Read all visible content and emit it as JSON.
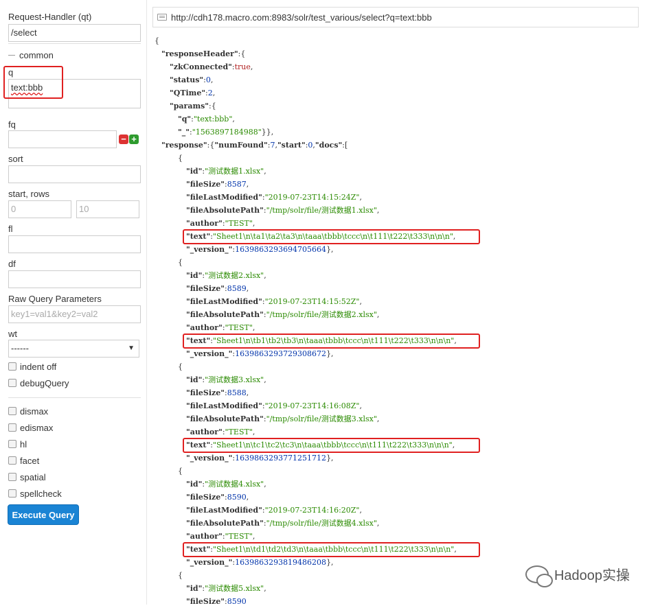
{
  "form": {
    "request_handler_label": "Request-Handler (qt)",
    "request_handler_value": "/select",
    "common_legend": "common",
    "q_label": "q",
    "q_value": "text:bbb",
    "fq_label": "fq",
    "sort_label": "sort",
    "start_rows_label": "start, rows",
    "start_placeholder": "0",
    "rows_placeholder": "10",
    "fl_label": "fl",
    "df_label": "df",
    "raw_params_label": "Raw Query Parameters",
    "raw_params_placeholder": "key1=val1&key2=val2",
    "wt_label": "wt",
    "wt_value": "------",
    "indent_off_label": "indent off",
    "debug_query_label": "debugQuery",
    "options": [
      "dismax",
      "edismax",
      "hl",
      "facet",
      "spatial",
      "spellcheck"
    ],
    "execute_label": "Execute Query"
  },
  "url": "http://cdh178.macro.com:8983/solr/test_various/select?q=text:bbb",
  "response": {
    "zkConnected": "true",
    "status": "0",
    "QTime": "2",
    "q": "\"text:bbb\"",
    "_": "\"1563897184988\"",
    "numFound": "7",
    "start": "0",
    "docs": [
      {
        "id": "\"测试数据1.xlsx\"",
        "fileSize": "8587",
        "fileLastModified": "\"2019-07-23T14:15:24Z\"",
        "fileAbsolutePath": "\"/tmp/solr/file/测试数据1.xlsx\"",
        "author": "\"TEST\"",
        "text": "\"Sheet1\\n\\ta1\\ta2\\ta3\\n\\taaa\\tbbb\\tccc\\n\\t111\\t222\\t333\\n\\n\\n\"",
        "version": "1639863293694705664"
      },
      {
        "id": "\"测试数据2.xlsx\"",
        "fileSize": "8589",
        "fileLastModified": "\"2019-07-23T14:15:52Z\"",
        "fileAbsolutePath": "\"/tmp/solr/file/测试数据2.xlsx\"",
        "author": "\"TEST\"",
        "text": "\"Sheet1\\n\\tb1\\tb2\\tb3\\n\\taaa\\tbbb\\tccc\\n\\t111\\t222\\t333\\n\\n\\n\"",
        "version": "1639863293729308672"
      },
      {
        "id": "\"测试数据3.xlsx\"",
        "fileSize": "8588",
        "fileLastModified": "\"2019-07-23T14:16:08Z\"",
        "fileAbsolutePath": "\"/tmp/solr/file/测试数据3.xlsx\"",
        "author": "\"TEST\"",
        "text": "\"Sheet1\\n\\tc1\\tc2\\tc3\\n\\taaa\\tbbb\\tccc\\n\\t111\\t222\\t333\\n\\n\\n\"",
        "version": "1639863293771251712"
      },
      {
        "id": "\"测试数据4.xlsx\"",
        "fileSize": "8590",
        "fileLastModified": "\"2019-07-23T14:16:20Z\"",
        "fileAbsolutePath": "\"/tmp/solr/file/测试数据4.xlsx\"",
        "author": "\"TEST\"",
        "text": "\"Sheet1\\n\\td1\\td2\\td3\\n\\taaa\\tbbb\\tccc\\n\\t111\\t222\\t333\\n\\n\\n\"",
        "version": "1639863293819486208"
      },
      {
        "id": "\"测试数据5.xlsx\"",
        "fileSize": "8590"
      }
    ]
  },
  "watermark": "Hadoop实操",
  "colors": {
    "highlight_box": "#e02020",
    "execute_button": "#1a84d4",
    "string_value": "#2a8a00",
    "number_value": "#0033aa"
  }
}
